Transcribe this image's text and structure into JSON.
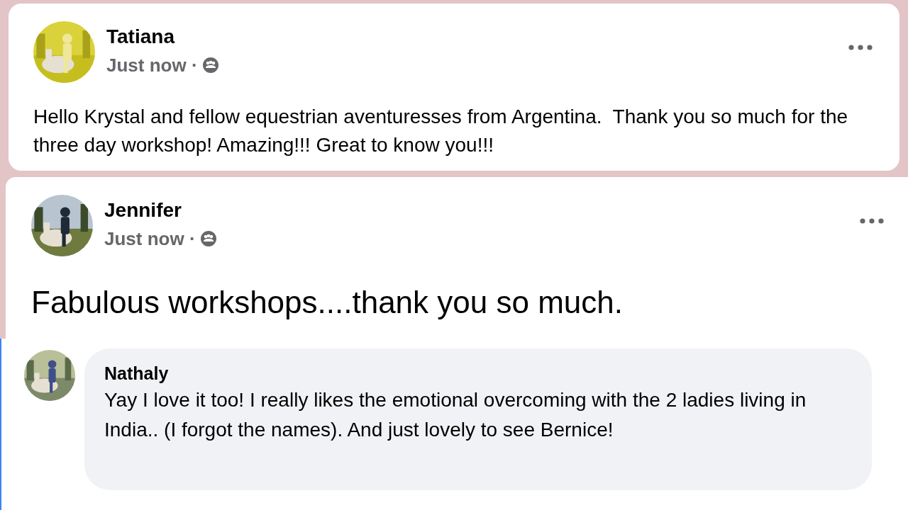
{
  "posts": [
    {
      "kind": "normal",
      "author": "Tatiana",
      "time": "Just now ·",
      "text": "Hello Krystal and fellow equestrian aventuresses from Argentina.  Thank you so much for the three day workshop! Amazing!!! Great to know you!!!"
    },
    {
      "kind": "large",
      "author": "Jennifer",
      "time": "Just now ·",
      "text": "Fabulous workshops....thank you so much."
    }
  ],
  "comment": {
    "author": "Nathaly",
    "text": "Yay I love it too! I really likes the emotional overcoming with the 2 ladies living in India.. (I forgot the names). And just lovely to see Bernice!"
  }
}
